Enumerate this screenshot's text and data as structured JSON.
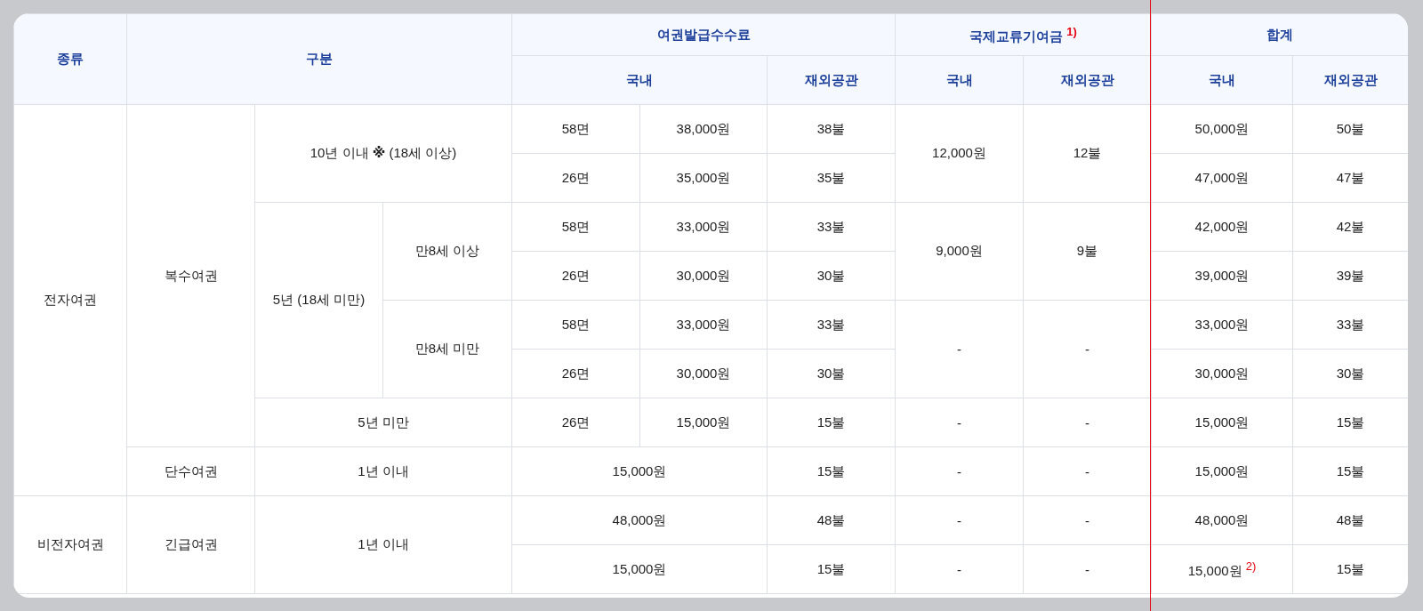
{
  "table": {
    "header_rows": [
      [
        {
          "text": "종류",
          "rowspan": 2
        },
        {
          "text": "구분",
          "colspan": 3,
          "rowspan": 2
        },
        {
          "text": "여권발급수수료",
          "colspan": 3
        },
        {
          "text": "국제교류기여금 $^{1)}$",
          "colspan": 2
        },
        {
          "text": "합계",
          "colspan": 2
        }
      ],
      [
        {
          "text": "국내",
          "colspan": 2
        },
        {
          "text": "재외공관"
        },
        {
          "text": "국내"
        },
        {
          "text": "재외공관"
        },
        {
          "text": "국내"
        },
        {
          "text": "재외공관"
        }
      ]
    ],
    "rows": [
      [
        {
          "text": "전자여권",
          "rowspan": 8
        },
        {
          "text": "복수여권",
          "rowspan": 7
        },
        {
          "text": "10년 이내 **※** (18세 이상)",
          "colspan": 2,
          "rowspan": 2
        },
        {
          "text": "58면"
        },
        {
          "text": "38,000원"
        },
        {
          "text": "38불"
        },
        {
          "text": "12,000원",
          "rowspan": 2
        },
        {
          "text": "12불",
          "rowspan": 2
        },
        {
          "text": "50,000원"
        },
        {
          "text": "50불"
        }
      ],
      [
        {
          "text": "26면"
        },
        {
          "text": "35,000원"
        },
        {
          "text": "35불"
        },
        {
          "text": "47,000원"
        },
        {
          "text": "47불"
        }
      ],
      [
        {
          "text": "5년 (18세 미만)",
          "rowspan": 4
        },
        {
          "text": "만8세 이상",
          "rowspan": 2
        },
        {
          "text": "58면"
        },
        {
          "text": "33,000원"
        },
        {
          "text": "33불"
        },
        {
          "text": "9,000원",
          "rowspan": 2
        },
        {
          "text": "9불",
          "rowspan": 2
        },
        {
          "text": "42,000원"
        },
        {
          "text": "42불"
        }
      ],
      [
        {
          "text": "26면"
        },
        {
          "text": "30,000원"
        },
        {
          "text": "30불"
        },
        {
          "text": "39,000원"
        },
        {
          "text": "39불"
        }
      ],
      [
        {
          "text": "만8세 미만",
          "rowspan": 2
        },
        {
          "text": "58면"
        },
        {
          "text": "33,000원"
        },
        {
          "text": "33불"
        },
        {
          "text": "-",
          "rowspan": 2
        },
        {
          "text": "-",
          "rowspan": 2
        },
        {
          "text": "33,000원"
        },
        {
          "text": "33불"
        }
      ],
      [
        {
          "text": "26면"
        },
        {
          "text": "30,000원"
        },
        {
          "text": "30불"
        },
        {
          "text": "30,000원"
        },
        {
          "text": "30불"
        }
      ],
      [
        {
          "text": "5년 미만",
          "colspan": 2
        },
        {
          "text": "26면"
        },
        {
          "text": "15,000원"
        },
        {
          "text": "15불"
        },
        {
          "text": "-"
        },
        {
          "text": "-"
        },
        {
          "text": "15,000원"
        },
        {
          "text": "15불"
        }
      ],
      [
        {
          "text": "단수여권"
        },
        {
          "text": "1년 이내",
          "colspan": 2
        },
        {
          "text": "15,000원",
          "colspan": 2
        },
        {
          "text": "15불"
        },
        {
          "text": "-"
        },
        {
          "text": "-"
        },
        {
          "text": "15,000원"
        },
        {
          "text": "15불"
        }
      ],
      [
        {
          "text": "비전자여권",
          "rowspan": 2
        },
        {
          "text": "긴급여권",
          "rowspan": 2
        },
        {
          "text": "1년 이내",
          "colspan": 2,
          "rowspan": 2
        },
        {
          "text": "48,000원",
          "colspan": 2
        },
        {
          "text": "48불"
        },
        {
          "text": "-"
        },
        {
          "text": "-"
        },
        {
          "text": "48,000원"
        },
        {
          "text": "48불"
        }
      ],
      [
        {
          "text": "15,000원",
          "colspan": 2
        },
        {
          "text": "15불"
        },
        {
          "text": "-"
        },
        {
          "text": "-"
        },
        {
          "text": "15,000원 $^{2)}$"
        },
        {
          "text": "15불"
        }
      ]
    ]
  }
}
